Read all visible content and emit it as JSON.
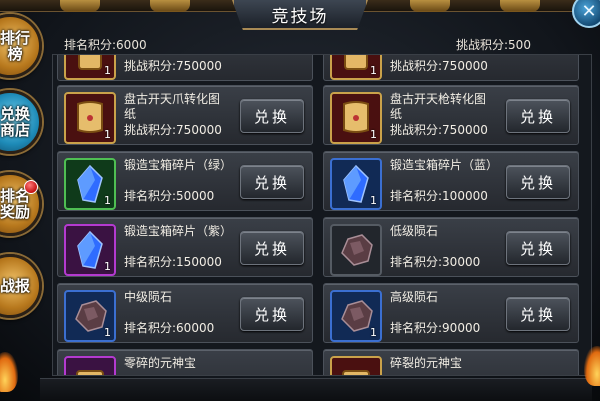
{
  "title": "竞技场",
  "close_label": "✕",
  "side_tabs": [
    {
      "label": "排行榜",
      "active": false
    },
    {
      "label": "兑换商店",
      "active": true
    },
    {
      "label": "排名奖励",
      "active": false,
      "has_badge": true
    },
    {
      "label": "战报",
      "active": false
    }
  ],
  "info": {
    "rank_points": "排名积分:6000",
    "challenge_points": "挑战积分:500"
  },
  "items": [
    {
      "name": "",
      "cost": "挑战积分:750000",
      "count": "1",
      "frame": "gold",
      "icon": "scroll-icon"
    },
    {
      "name": "",
      "cost": "挑战积分:750000",
      "count": "1",
      "frame": "gold",
      "icon": "scroll-icon"
    },
    {
      "name": "盘古开天爪转化图纸",
      "cost": "挑战积分:750000",
      "count": "1",
      "frame": "gold",
      "icon": "scroll-icon",
      "button": "兑换"
    },
    {
      "name": "盘古开天枪转化图纸",
      "cost": "挑战积分:750000",
      "count": "1",
      "frame": "gold",
      "icon": "scroll-icon",
      "button": "兑换"
    },
    {
      "name": "锻造宝箱碎片（绿）",
      "cost": "排名积分:50000",
      "count": "1",
      "frame": "green",
      "icon": "crystal-icon",
      "button": "兑换"
    },
    {
      "name": "锻造宝箱碎片（蓝）",
      "cost": "排名积分:100000",
      "count": "1",
      "frame": "blue",
      "icon": "crystal-icon",
      "button": "兑换"
    },
    {
      "name": "锻造宝箱碎片（紫）",
      "cost": "排名积分:150000",
      "count": "1",
      "frame": "purple",
      "icon": "crystal-icon",
      "button": "兑换"
    },
    {
      "name": "低级陨石",
      "cost": "排名积分:30000",
      "count": "1",
      "frame": "none",
      "icon": "meteorite-icon",
      "button": "兑换"
    },
    {
      "name": "中级陨石",
      "cost": "排名积分:60000",
      "count": "1",
      "frame": "blue",
      "icon": "meteorite-icon",
      "button": "兑换"
    },
    {
      "name": "高级陨石",
      "cost": "排名积分:90000",
      "count": "1",
      "frame": "blue",
      "icon": "meteorite-icon",
      "button": "兑换"
    },
    {
      "name": "零碎的元神宝",
      "cost": "",
      "count": "",
      "frame": "purple",
      "icon": "scroll-icon"
    },
    {
      "name": "碎裂的元神宝",
      "cost": "",
      "count": "",
      "frame": "gold",
      "icon": "scroll-icon"
    }
  ]
}
